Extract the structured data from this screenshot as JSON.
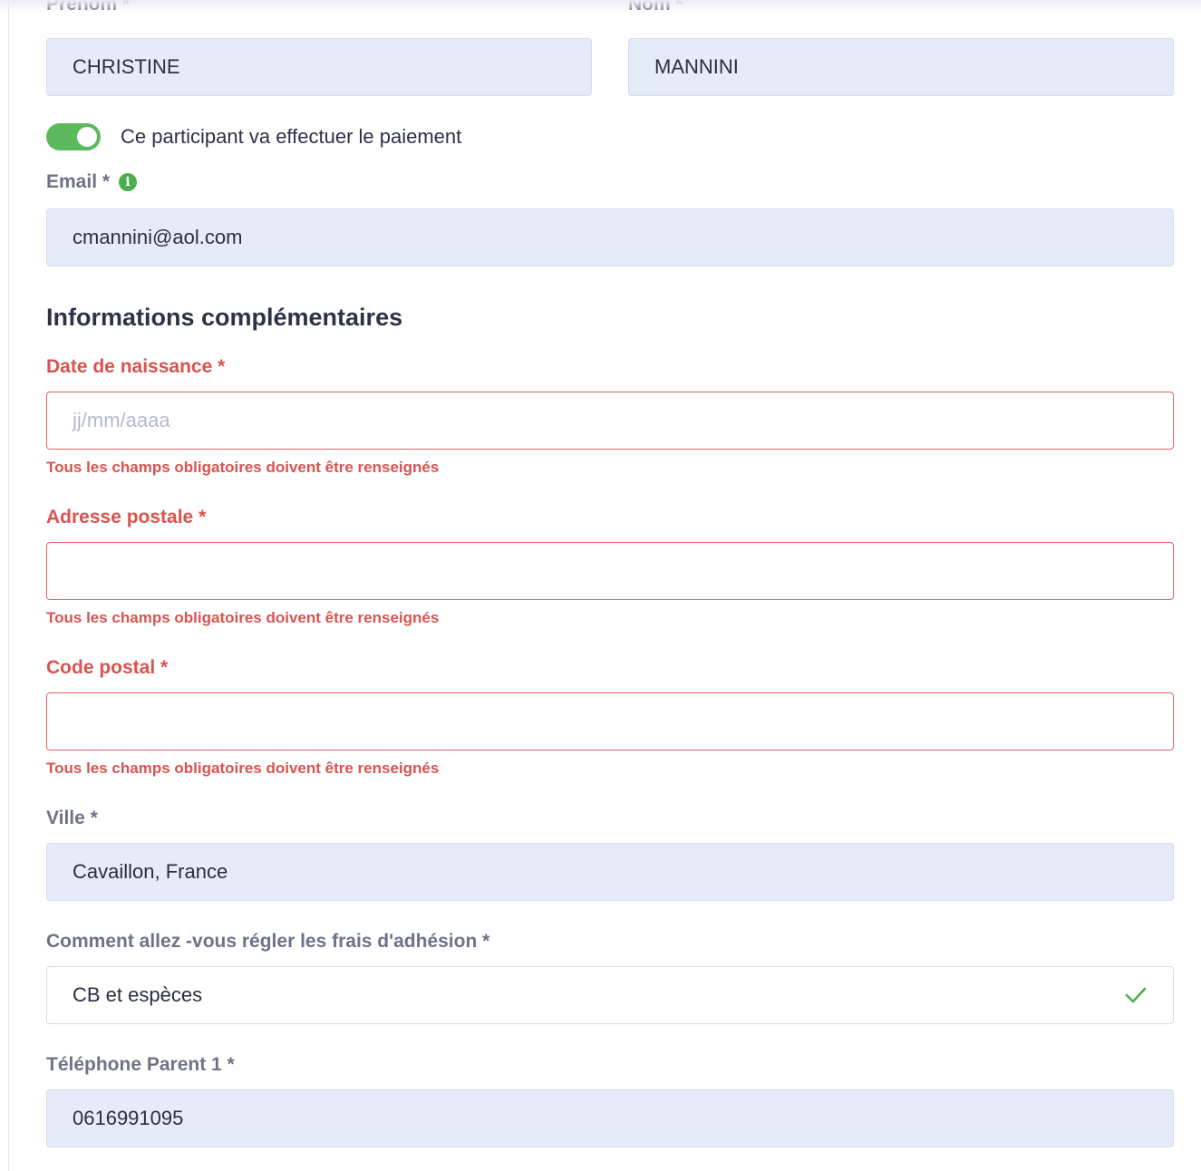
{
  "identity": {
    "first_name_label": "Prénom *",
    "first_name_value": "CHRISTINE",
    "last_name_label": "Nom *",
    "last_name_value": "MANNINI"
  },
  "payer_toggle": {
    "label": "Ce participant va effectuer le paiement",
    "state": "on"
  },
  "email": {
    "label": "Email *",
    "info_icon": "i",
    "value": "cmannini@aol.com"
  },
  "section": {
    "title": "Informations complémentaires"
  },
  "birth_date": {
    "label": "Date de naissance *",
    "placeholder": "jj/mm/aaaa",
    "error": "Tous les champs obligatoires doivent être renseignés"
  },
  "address": {
    "label": "Adresse postale *",
    "value": "",
    "error": "Tous les champs obligatoires doivent être renseignés"
  },
  "postal_code": {
    "label": "Code postal *",
    "value": "",
    "error": "Tous les champs obligatoires doivent être renseignés"
  },
  "city": {
    "label": "Ville *",
    "value": "Cavaillon, France"
  },
  "payment_method": {
    "label": "Comment allez -vous régler les frais d'adhésion *",
    "value": "CB et espèces",
    "status_icon": "check-icon"
  },
  "phone": {
    "label": "Téléphone Parent 1 *",
    "value": "0616991095"
  },
  "colors": {
    "error": "#d9534f",
    "toggle_on": "#5cb85c",
    "field_bg": "#e6ebfa",
    "check": "#4cae4c"
  }
}
